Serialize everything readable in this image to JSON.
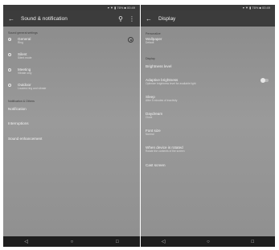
{
  "left": {
    "status": "▾ ▼ ▮ 76% ■ 00:49",
    "title": "Sound & notification",
    "section_sound": "Sound general settings",
    "profiles": [
      {
        "title": "General",
        "subtitle": "Ring",
        "selected": true
      },
      {
        "title": "Silent",
        "subtitle": "Silent mode",
        "selected": false
      },
      {
        "title": "Meeting",
        "subtitle": "Vibrate only",
        "selected": false
      },
      {
        "title": "Outdoor",
        "subtitle": "Loudest ring and vibrate",
        "selected": false
      }
    ],
    "section_notification": "Notification & Others",
    "items": [
      "Notification",
      "Interruptions",
      "Sound enhancement"
    ]
  },
  "right": {
    "status": "▾ ▼ ▮ 76% ■ 00:49",
    "title": "Display",
    "section_personalize": "Personalize",
    "wallpaper": {
      "title": "Wallpaper",
      "subtitle": "Default"
    },
    "section_display": "Display",
    "brightness_level": "Brightness level",
    "adaptive": {
      "title": "Adaptive brightness",
      "subtitle": "Optimize brightness level for available light"
    },
    "sleep": {
      "title": "Sleep",
      "subtitle": "After 5 minutes of inactivity"
    },
    "daydream": {
      "title": "Daydream",
      "subtitle": "Clock"
    },
    "font_size": {
      "title": "Font size",
      "subtitle": "Normal"
    },
    "rotate": {
      "title": "When device is rotated",
      "subtitle": "Rotate the contents of the screen"
    },
    "cast": "Cast screen"
  },
  "nav": {
    "back": "◁",
    "home": "○",
    "recents": "□"
  }
}
